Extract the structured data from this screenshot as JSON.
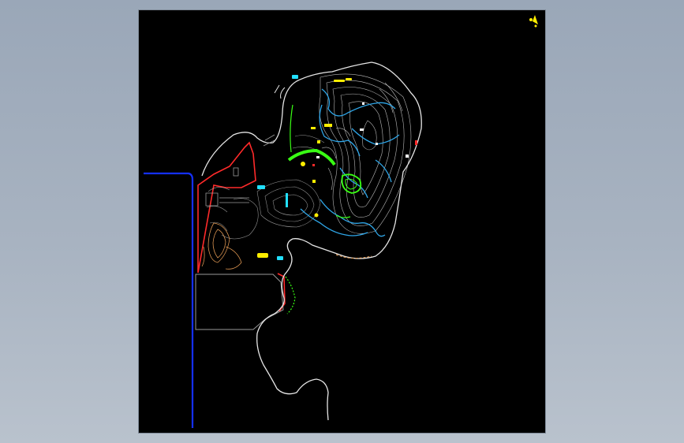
{
  "viewer": {
    "background_top": "#9aa7b8",
    "background_bottom": "#b9c2cd",
    "sheet_color": "#000000"
  },
  "drawing": {
    "type": "cad-site-plan",
    "linework_colors": {
      "contours": "#d9d9d9",
      "boundary": "#e6e6e6",
      "water": "#2fa6e8",
      "green_zone": "#39ff14",
      "red_edge": "#ff2a2a",
      "blue_edge": "#1430ff",
      "yellow_marks": "#ffee00",
      "orange_contours": "#f3a55a",
      "cyan_marks": "#22e0ff"
    },
    "icons": [
      "north-arrow-icon"
    ]
  }
}
